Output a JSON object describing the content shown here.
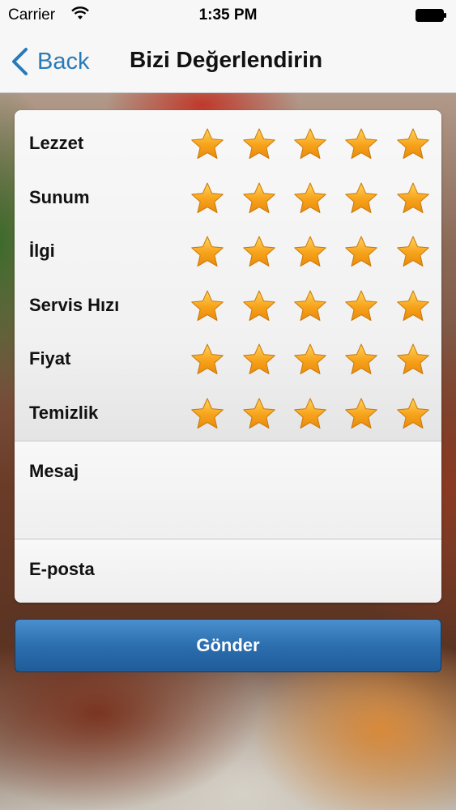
{
  "status_bar": {
    "carrier": "Carrier",
    "time": "1:35 PM"
  },
  "nav": {
    "back_label": "Back",
    "title": "Bizi Değerlendirin"
  },
  "ratings": [
    {
      "label": "Lezzet",
      "stars": 5
    },
    {
      "label": "Sunum",
      "stars": 5
    },
    {
      "label": "İlgi",
      "stars": 5
    },
    {
      "label": "Servis Hızı",
      "stars": 5
    },
    {
      "label": "Fiyat",
      "stars": 5
    },
    {
      "label": "Temizlik",
      "stars": 5
    }
  ],
  "form": {
    "message_label": "Mesaj",
    "email_label": "E-posta"
  },
  "submit_label": "Gönder",
  "colors": {
    "accent": "#2a7ab8",
    "button": "#2c6eaf",
    "star_fill": "#f7a21b"
  },
  "icons": {
    "back": "chevron-left-icon",
    "star": "star-icon",
    "wifi": "wifi-icon",
    "battery": "battery-icon"
  }
}
